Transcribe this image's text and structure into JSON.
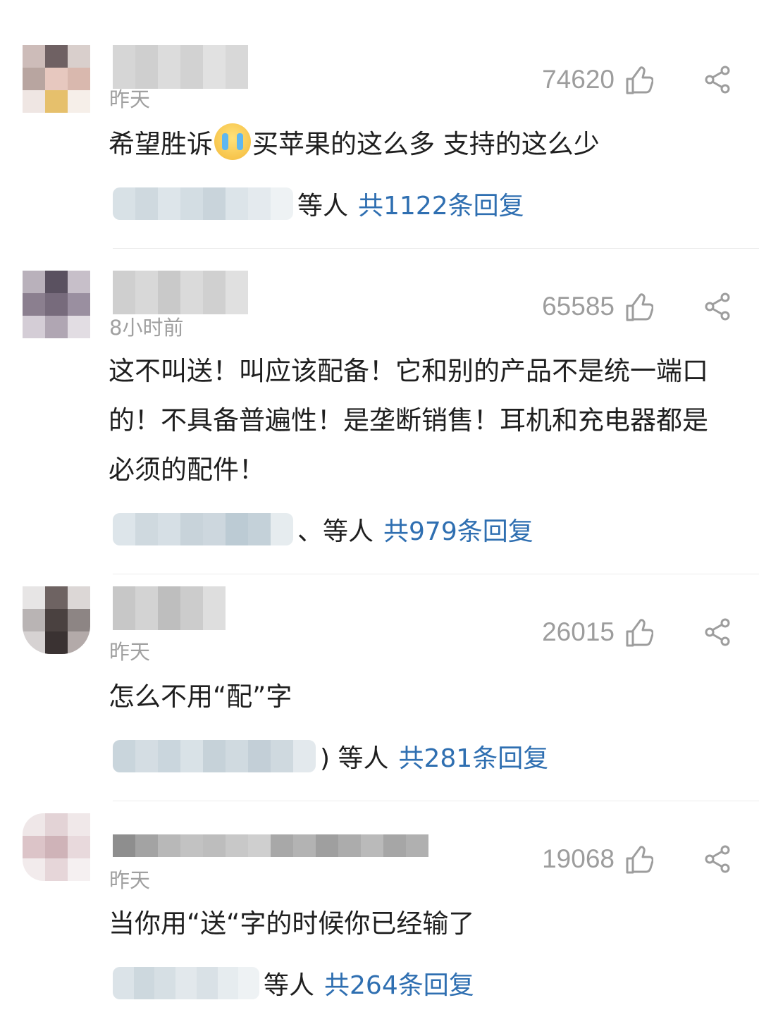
{
  "comments": [
    {
      "time": "昨天",
      "likes": "74620",
      "text_before": "希望胜诉",
      "emoji": "crying-face",
      "text_after": "买苹果的这么多 支持的这么少",
      "reply_suffix": "等人",
      "reply_count": "共1122条回复"
    },
    {
      "time": "8小时前",
      "likes": "65585",
      "text": "这不叫送！叫应该配备！它和别的产品不是统一端口的！不具备普遍性！是垄断销售！耳机和充电器都是必须的配件！",
      "reply_suffix": "、等人",
      "reply_count": "共979条回复"
    },
    {
      "time": "昨天",
      "likes": "26015",
      "text": "怎么不用“配”字",
      "reply_suffix": ") 等人",
      "reply_count": "共281条回复"
    },
    {
      "time": "昨天",
      "likes": "19068",
      "text": "当你用“送“字的时候你已经输了",
      "reply_suffix": "等人",
      "reply_count": "共264条回复"
    }
  ],
  "colors": {
    "reply_link": "#2f6fb1",
    "meta_gray": "#a0a0a0"
  },
  "icons": [
    "thumb-up-icon",
    "share-icon",
    "crying-face-emoji"
  ]
}
